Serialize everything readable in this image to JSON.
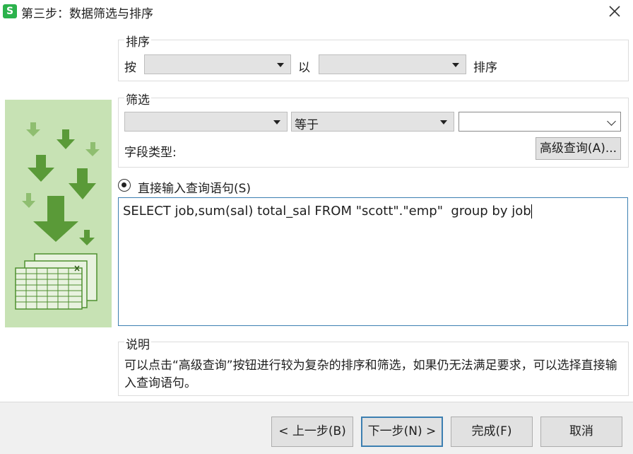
{
  "window": {
    "app_icon_letter": "S",
    "title": "第三步：数据筛选与排序"
  },
  "sort": {
    "title": "排序",
    "by_label": "按",
    "field_value": "",
    "with_label": "以",
    "order_value": "",
    "suffix_label": "排序"
  },
  "filter": {
    "title": "筛选",
    "field_value": "",
    "operator_value": "等于",
    "value": "",
    "field_type_label": "字段类型:",
    "advanced_button": "高级查询(A)..."
  },
  "direct": {
    "radio_label": "直接输入查询语句(S)",
    "selected": true,
    "sql": "SELECT job,sum(sal) total_sal FROM \"scott\".\"emp\"  group by job"
  },
  "description": {
    "title": "说明",
    "text": "可以点击“高级查询”按钮进行较为复杂的排序和筛选，如果仍无法满足要求，可以选择直接输入查询语句。"
  },
  "buttons": {
    "prev": "< 上一步(B)",
    "next": "下一步(N) >",
    "finish": "完成(F)",
    "cancel": "取消"
  },
  "colors": {
    "illustration_bg": "#c7e2b4",
    "arrow_dark": "#4e8f2f",
    "arrow_light": "#8fbe70",
    "focus_border": "#3c7fb1"
  }
}
